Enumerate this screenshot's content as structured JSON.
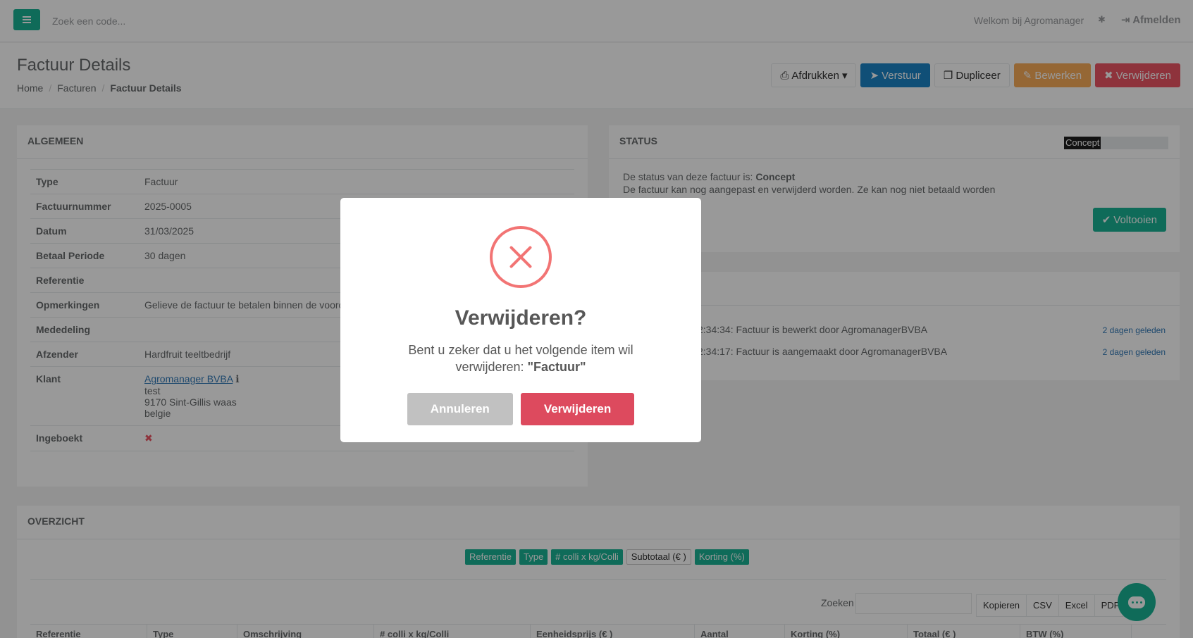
{
  "topbar": {
    "search_placeholder": "Zoek een code...",
    "welcome": "Welkom bij Agromanager",
    "logout": "Afmelden"
  },
  "heading": {
    "title": "Factuur Details",
    "breadcrumb": [
      "Home",
      "Facturen",
      "Factuur Details"
    ],
    "actions": {
      "print": "Afdrukken",
      "send": "Verstuur",
      "duplicate": "Dupliceer",
      "edit": "Bewerken",
      "delete": "Verwijderen"
    }
  },
  "algemeen": {
    "title": "ALGEMEEN",
    "rows": [
      {
        "label": "Type",
        "value": "Factuur"
      },
      {
        "label": "Factuurnummer",
        "value": "2025-0005"
      },
      {
        "label": "Datum",
        "value": "31/03/2025"
      },
      {
        "label": "Betaal Periode",
        "value": "30 dagen"
      },
      {
        "label": "Referentie",
        "value": ""
      },
      {
        "label": "Opmerkingen",
        "value": "Gelieve de factuur te betalen binnen de vooro"
      },
      {
        "label": "Mededeling",
        "value": ""
      },
      {
        "label": "Afzender",
        "value": "Hardfruit teeltbedrijf"
      }
    ],
    "klant": {
      "label": "Klant",
      "name": "Agromanager BVBA",
      "line1": "test",
      "line2": "9170 Sint-Gillis waas",
      "line3": "belgie"
    },
    "ingeboekt_label": "Ingeboekt"
  },
  "status": {
    "title": "STATUS",
    "badge": "Concept",
    "line1_prefix": "De status van deze factuur is: ",
    "line1_value": "Concept",
    "line2": "De factuur kan nog aangepast en verwijderd worden. Ze kan nog niet betaald worden",
    "complete_button": "Voltooien"
  },
  "log": {
    "entries": [
      {
        "text": "2:34:34: Factuur is bewerkt door AgromanagerBVBA",
        "ago": "2 dagen geleden"
      },
      {
        "text": "2:34:17: Factuur is aangemaakt door AgromanagerBVBA",
        "ago": "2 dagen geleden"
      }
    ]
  },
  "overzicht": {
    "title": "OVERZICHT",
    "column_toggles": [
      {
        "label": "Referentie",
        "active": true
      },
      {
        "label": "Type",
        "active": true
      },
      {
        "label": "# colli x kg/Colli",
        "active": true
      },
      {
        "label": "Subtotaal (€ )",
        "active": false
      },
      {
        "label": "Korting (%)",
        "active": true
      }
    ],
    "search_label": "Zoeken",
    "export_buttons": [
      "Kopieren",
      "CSV",
      "Excel",
      "PDF"
    ],
    "columns": [
      "Referentie",
      "Type",
      "Omschrijving",
      "# colli x kg/Colli",
      "Eenheidsprijs (€ )",
      "Aantal",
      "Korting (%)",
      "Totaal (€ )",
      "BTW (%)"
    ]
  },
  "modal": {
    "title": "Verwijderen?",
    "text": "Bent u zeker dat u het volgende item wil verwijderen: ",
    "item": "\"Factuur\"",
    "cancel": "Annuleren",
    "confirm": "Verwijderen"
  },
  "colors": {
    "primary": "#1ab394",
    "blue": "#1c84c6",
    "warning": "#f8ac59",
    "danger": "#ed5565"
  }
}
